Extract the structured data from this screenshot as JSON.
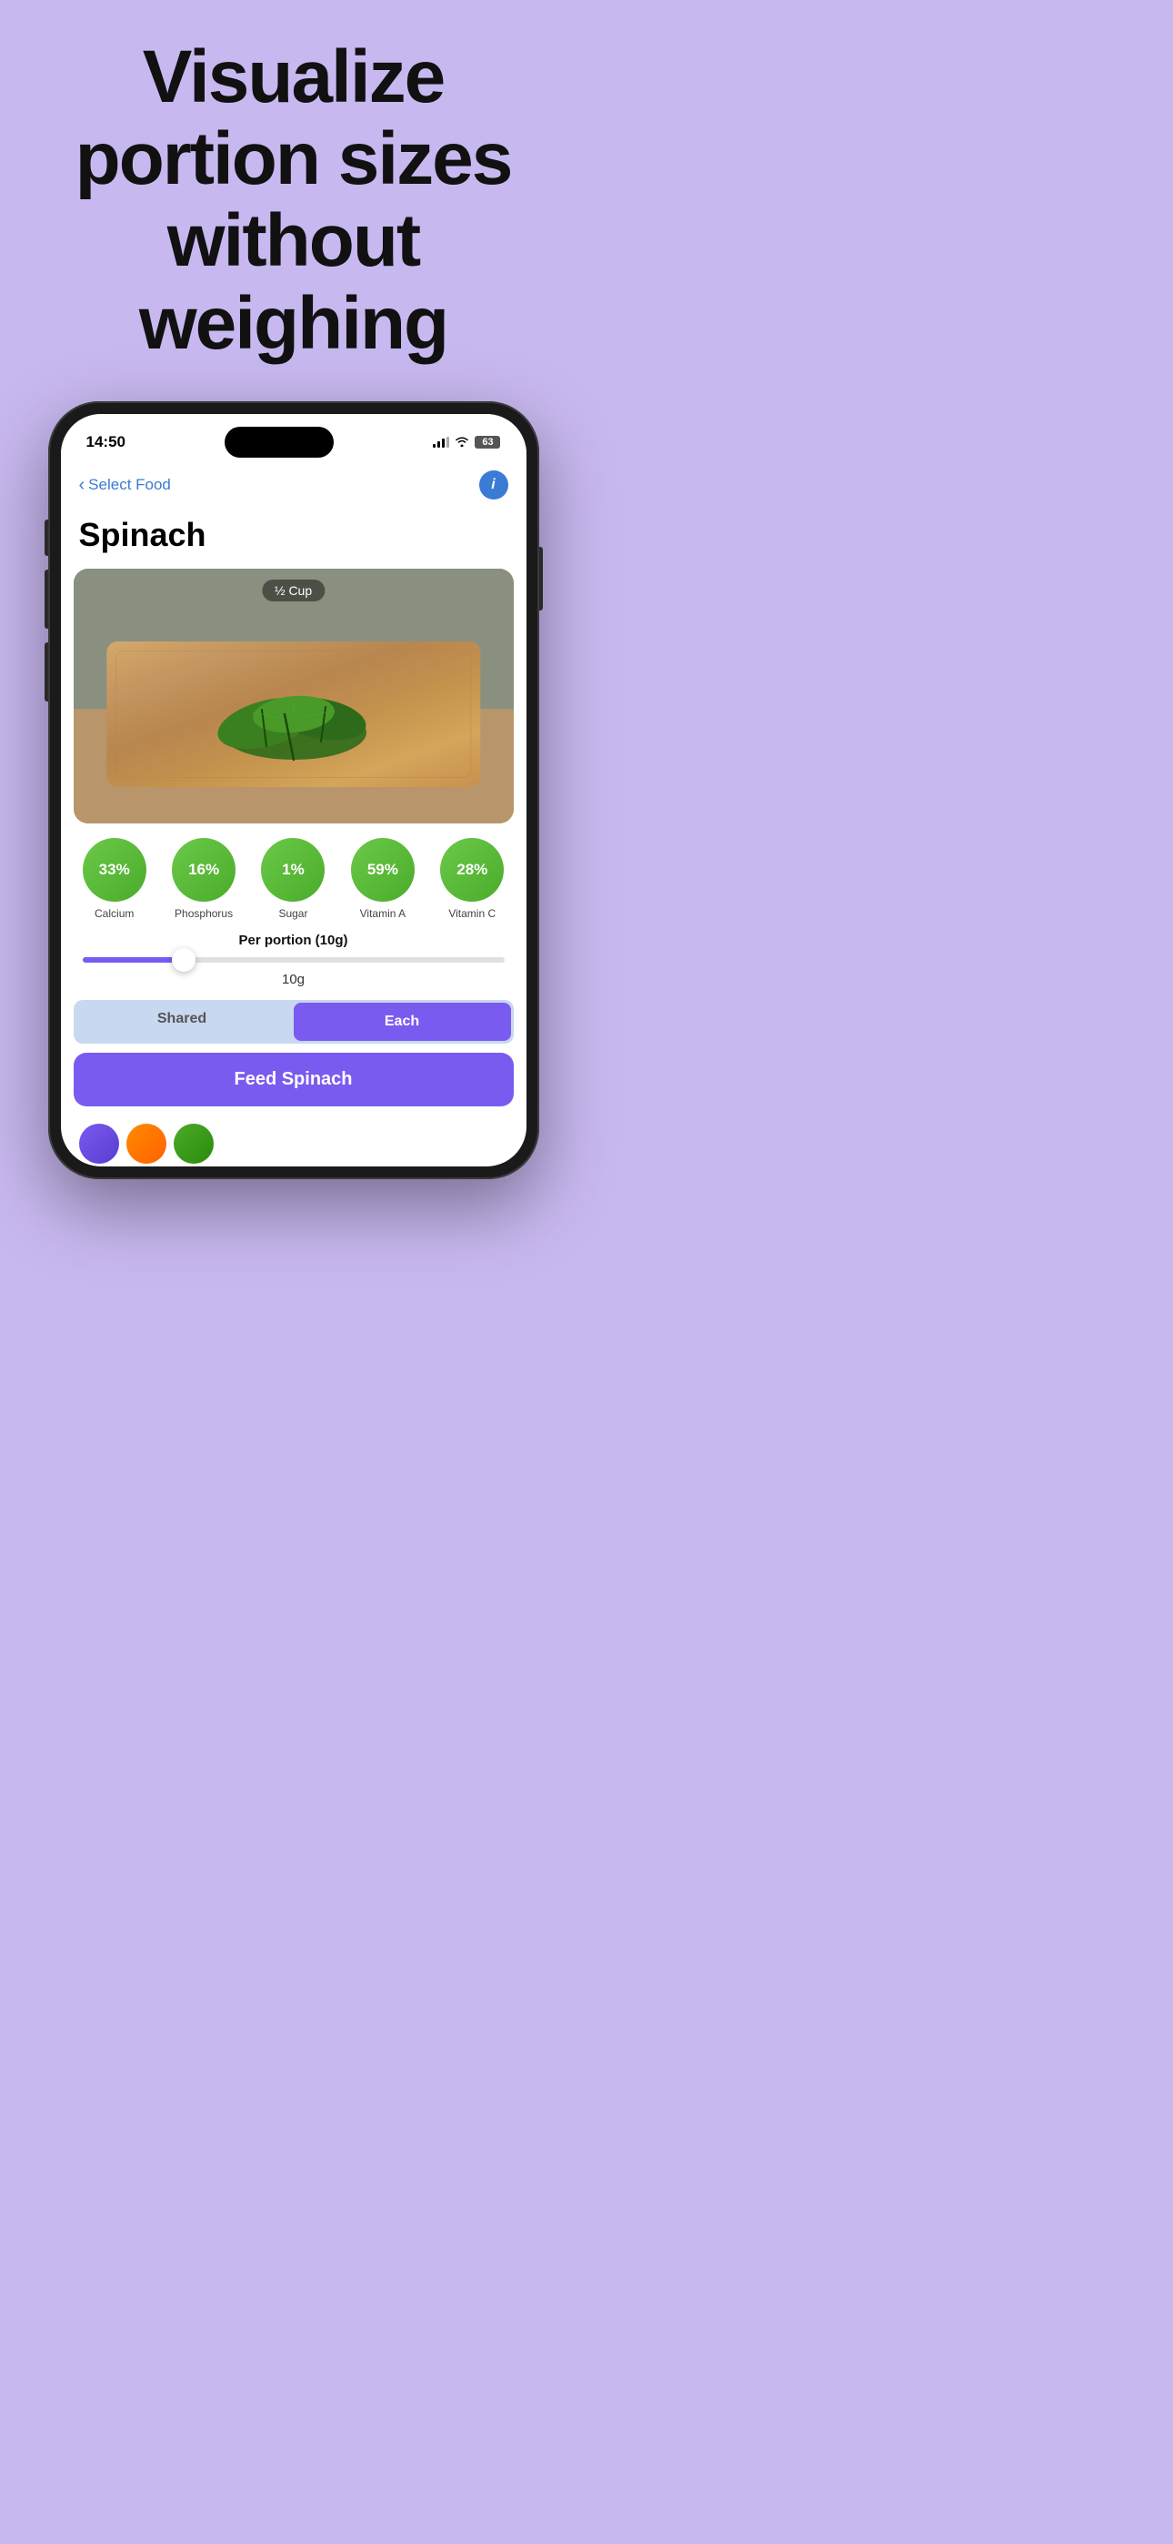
{
  "hero": {
    "line1": "Visualize",
    "line2": "portion sizes",
    "line3": "without",
    "line4": "weighing"
  },
  "status_bar": {
    "time": "14:50",
    "battery": "63"
  },
  "nav": {
    "back_label": "Select Food",
    "info_label": "i"
  },
  "food": {
    "title": "Spinach",
    "image_label": "½ Cup"
  },
  "nutrients": [
    {
      "pct": "33%",
      "label": "Calcium"
    },
    {
      "pct": "16%",
      "label": "Phosphorus"
    },
    {
      "pct": "1%",
      "label": "Sugar"
    },
    {
      "pct": "59%",
      "label": "Vitamin A"
    },
    {
      "pct": "28%",
      "label": "Vitamin C"
    }
  ],
  "per_portion": "Per portion (10g)",
  "slider": {
    "value": "10g"
  },
  "toggle": {
    "shared_label": "Shared",
    "each_label": "Each"
  },
  "feed_button": "Feed Spinach"
}
